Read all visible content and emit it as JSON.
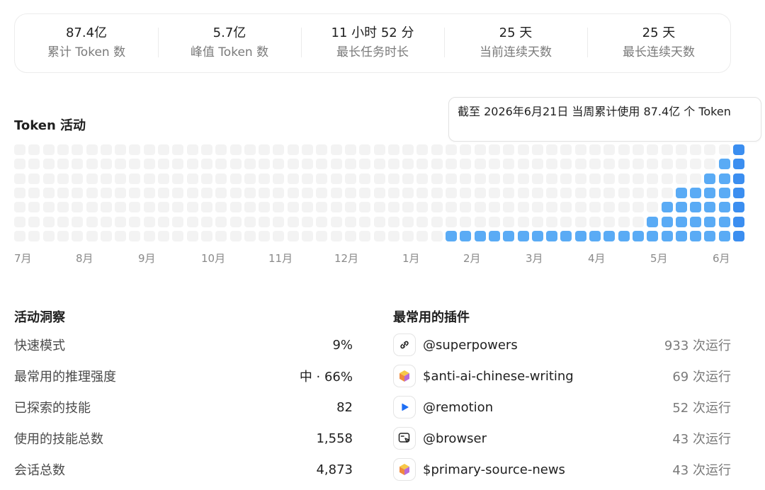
{
  "stats": [
    {
      "value": "87.4亿",
      "label": "累计 Token 数"
    },
    {
      "value": "5.7亿",
      "label": "峰值 Token 数"
    },
    {
      "value": "11 小时 52 分",
      "label": "最长任务时长"
    },
    {
      "value": "25 天",
      "label": "当前连续天数"
    },
    {
      "value": "25 天",
      "label": "最长连续天数"
    }
  ],
  "activity": {
    "title": "Token 活动",
    "tooltip": "截至 2026年6月21日 当周累计使用 87.4亿 个 Token",
    "months": [
      "7月",
      "8月",
      "9月",
      "10月",
      "11月",
      "12月",
      "1月",
      "2月",
      "3月",
      "4月",
      "5月",
      "6月"
    ],
    "weekly_levels": [
      0,
      0,
      0,
      0,
      0,
      0,
      0,
      0,
      0,
      0,
      0,
      0,
      0,
      0,
      0,
      0,
      0,
      0,
      0,
      0,
      0,
      0,
      0,
      0,
      0,
      0,
      0,
      0,
      0,
      0,
      1,
      1,
      1,
      1,
      1,
      1,
      1,
      1,
      1,
      1,
      1,
      1,
      1,
      1,
      2,
      3,
      4,
      4,
      5,
      6,
      7
    ],
    "colors": {
      "empty": "#f3f3f3",
      "filled": "#5aabf5",
      "latest": "#3b8ef0"
    }
  },
  "insights": {
    "title": "活动洞察",
    "rows": [
      {
        "label": "快速模式",
        "value": "9%"
      },
      {
        "label": "最常用的推理强度",
        "value": "中 · 66%"
      },
      {
        "label": "已探索的技能",
        "value": "82"
      },
      {
        "label": "使用的技能总数",
        "value": "1,558"
      },
      {
        "label": "会话总数",
        "value": "4,873"
      }
    ]
  },
  "plugins": {
    "title": "最常用的插件",
    "rows": [
      {
        "icon": "link-icon",
        "name": "@superpowers",
        "count": "933 次运行"
      },
      {
        "icon": "cube-icon",
        "name": "$anti-ai-chinese-writing",
        "count": "69 次运行"
      },
      {
        "icon": "play-icon",
        "name": "@remotion",
        "count": "52 次运行"
      },
      {
        "icon": "browser-cursor-icon",
        "name": "@browser",
        "count": "43 次运行"
      },
      {
        "icon": "cube-icon",
        "name": "$primary-source-news",
        "count": "43 次运行"
      }
    ]
  }
}
